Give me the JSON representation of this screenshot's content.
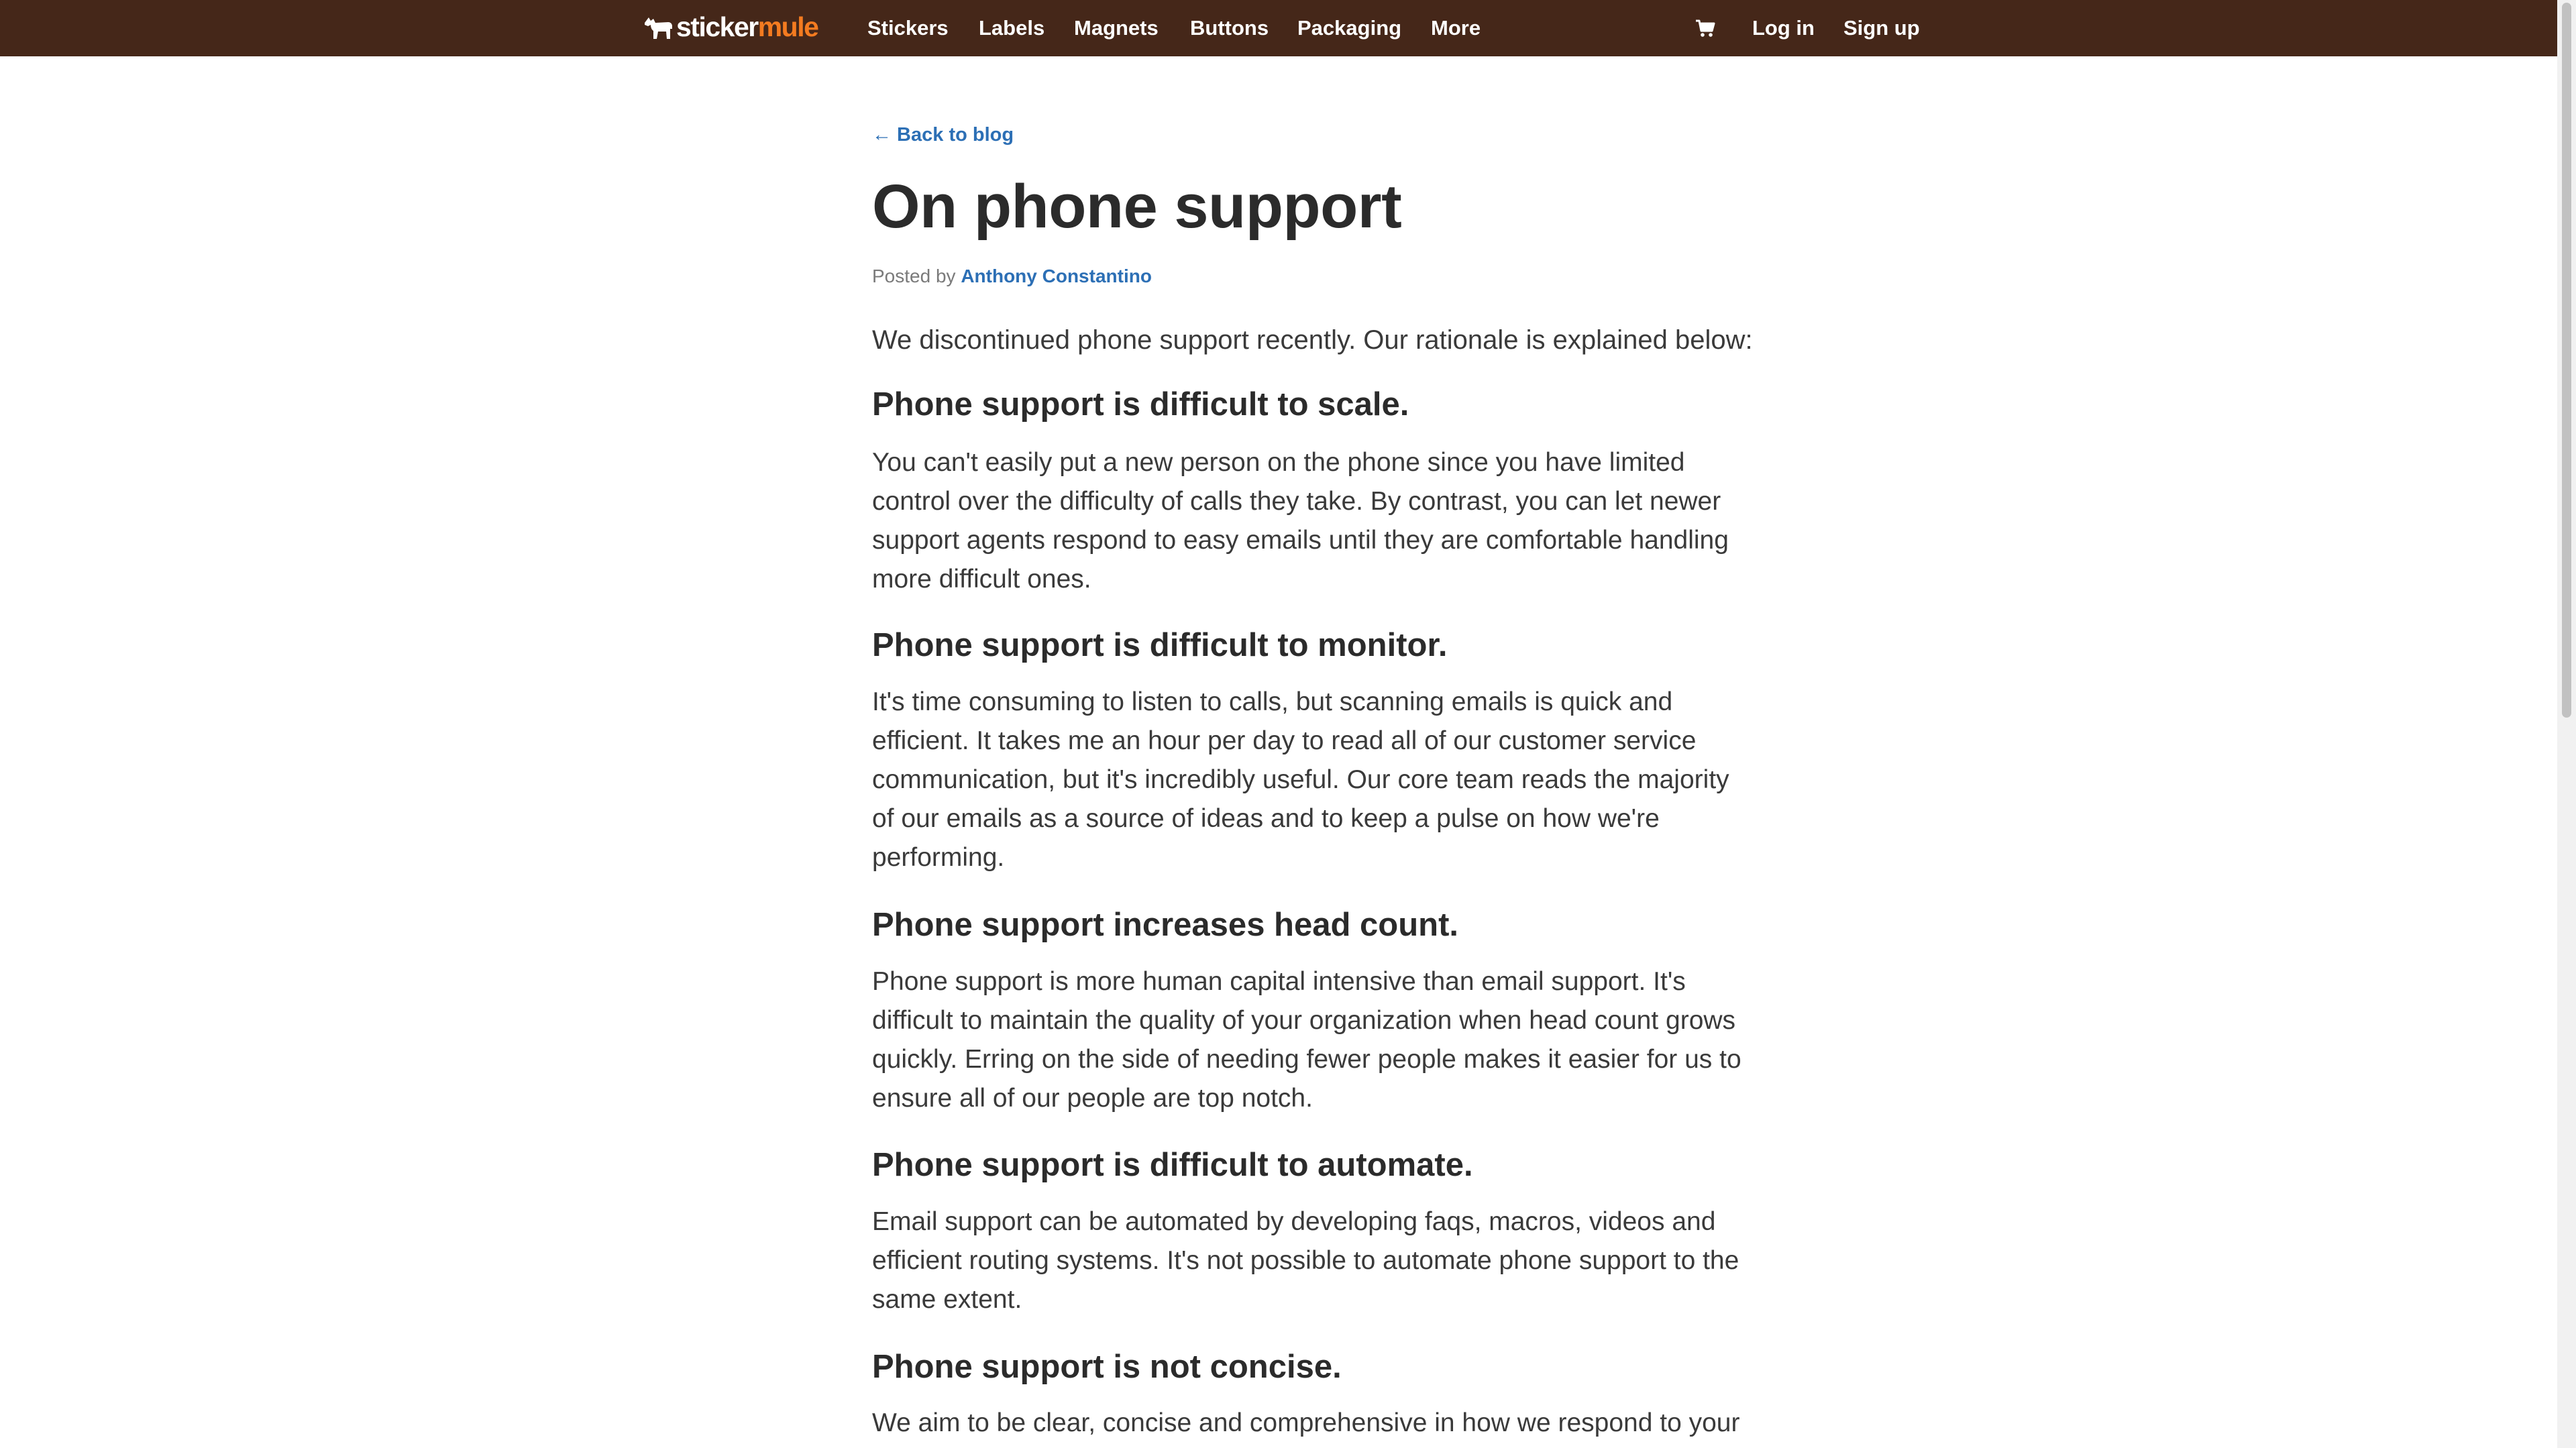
{
  "nav": {
    "logo_sticker": "sticker",
    "logo_mule": "mule",
    "links": [
      "Stickers",
      "Labels",
      "Magnets",
      "Buttons",
      "Packaging",
      "More"
    ],
    "cart_icon": "cart-icon",
    "login": "Log in",
    "signup": "Sign up",
    "colors": {
      "bar": "#452719",
      "brand_orange": "#f47b20",
      "link_blue": "#2c6fb5"
    }
  },
  "article": {
    "back_link": "← Back to blog",
    "title": "On phone support",
    "byline_prefix": "Posted by",
    "author": "Anthony Constantino",
    "intro": "We discontinued phone support recently. Our rationale is explained below:",
    "sections": [
      {
        "heading": "Phone support is difficult to scale.",
        "lines": [
          "You can't easily put a new person on the phone since you have limited",
          "control over the difficulty of calls they take. By contrast, you can let newer",
          "support agents respond to easy emails until they are comfortable handling",
          "more difficult ones."
        ]
      },
      {
        "heading": "Phone support is difficult to monitor.",
        "lines": [
          "It's time consuming to listen to calls, but scanning emails is quick and",
          "efficient. It takes me an hour per day to read all of our customer service",
          "communication, but it's incredibly useful. Our core team reads the majority",
          "of our emails as a source of ideas and to keep a pulse on how we're",
          "performing."
        ]
      },
      {
        "heading": "Phone support increases head count.",
        "lines": [
          "Phone support is more human capital intensive than email support. It's",
          "difficult to maintain the quality of your organization when head count grows",
          "quickly. Erring on the side of needing fewer people makes it easier for us to",
          "ensure all of our people are top notch."
        ]
      },
      {
        "heading": "Phone support is difficult to automate.",
        "lines": [
          "Email support can be automated by developing faqs, macros, videos and",
          "efficient routing systems. It's not possible to automate phone support to the",
          "same extent."
        ]
      },
      {
        "heading": "Phone support is not concise.",
        "lines": [
          "We aim to be clear, concise and comprehensive in how we respond to your"
        ]
      }
    ]
  }
}
